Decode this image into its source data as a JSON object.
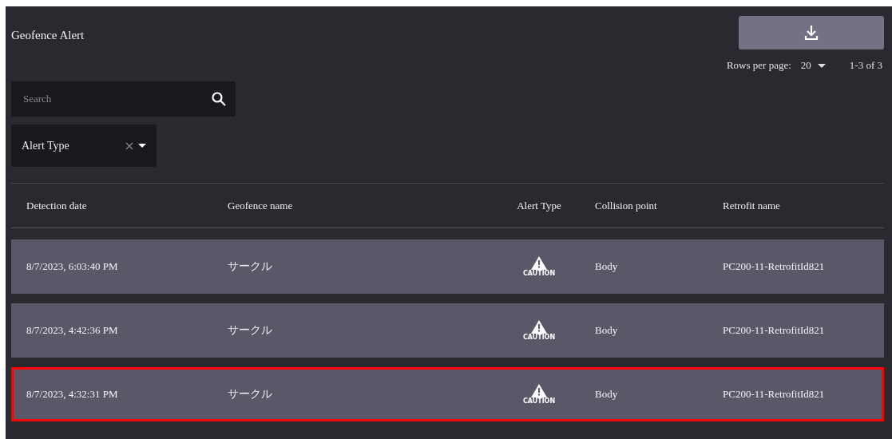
{
  "title": "Geofence Alert",
  "pagination": {
    "rows_per_page_label": "Rows per page:",
    "rows_per_page": "20",
    "range": "1-3 of 3"
  },
  "search": {
    "placeholder": "Search"
  },
  "filter": {
    "label": "Alert Type"
  },
  "table": {
    "columns": [
      "Detection date",
      "Geofence name",
      "Alert Type",
      "Collision point",
      "Retrofit name"
    ],
    "rows": [
      {
        "date": "8/7/2023, 6:03:40 PM",
        "geofence": "サークル",
        "alert": {
          "kind": "caution",
          "label": "CAUTION"
        },
        "collision": "Body",
        "retrofit": "PC200-11-RetrofitId821",
        "highlighted": false
      },
      {
        "date": "8/7/2023, 4:42:36 PM",
        "geofence": "サークル",
        "alert": {
          "kind": "caution",
          "label": "CAUTION"
        },
        "collision": "Body",
        "retrofit": "PC200-11-RetrofitId821",
        "highlighted": false
      },
      {
        "date": "8/7/2023, 4:32:31 PM",
        "geofence": "サークル",
        "alert": {
          "kind": "caution",
          "label": "CAUTION"
        },
        "collision": "Body",
        "retrofit": "PC200-11-RetrofitId821",
        "highlighted": true
      }
    ]
  }
}
